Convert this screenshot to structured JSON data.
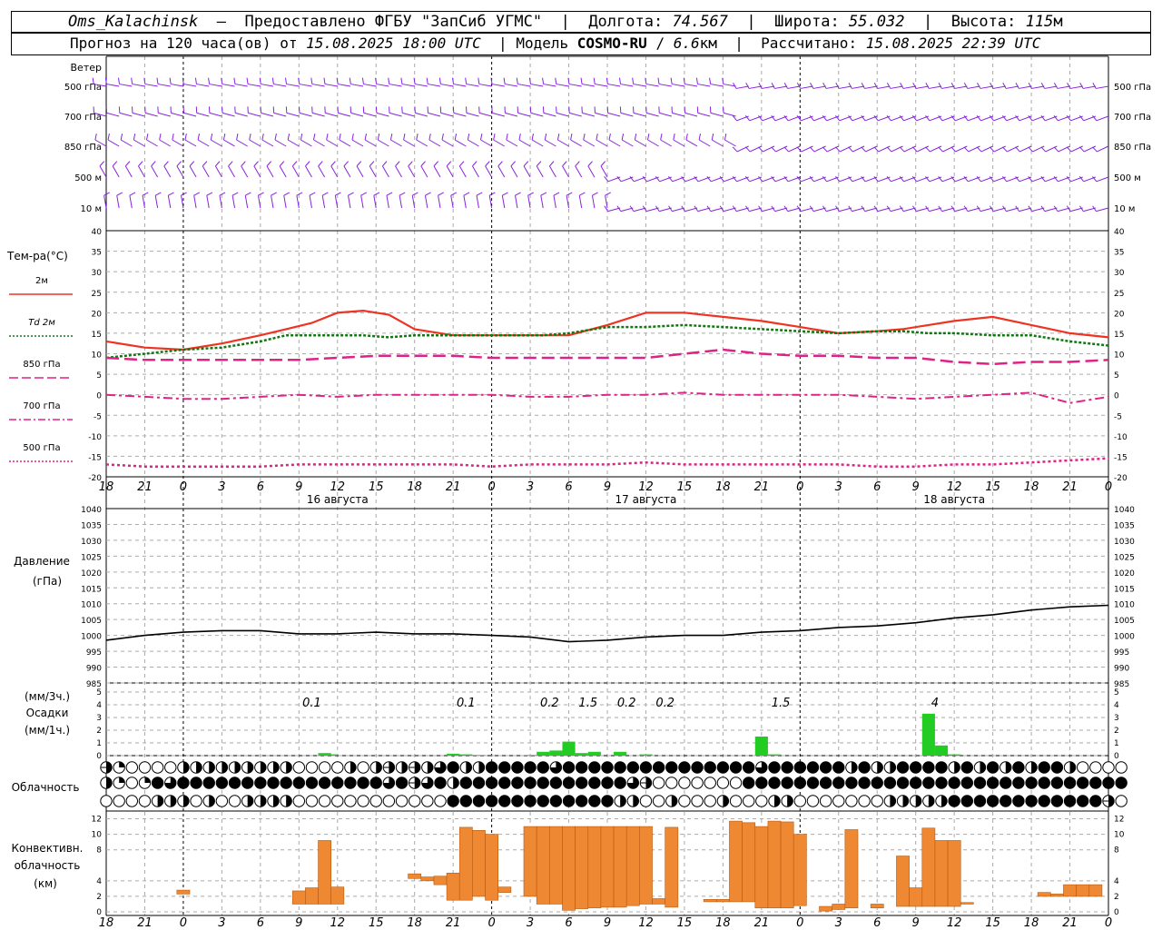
{
  "header": {
    "station": "Oms_Kalachinsk",
    "dash": "–",
    "provider": "Предоставлено ФГБУ \"ЗапСиб УГМС\"",
    "sep": "|",
    "lon_label": "Долгота:",
    "lon_value": "74.567",
    "lat_label": "Широта:",
    "lat_value": "55.032",
    "alt_label": "Высота:",
    "alt_value": "115",
    "alt_unit": "м",
    "forecast_label": "Прогноз на 120 часа(ов) от",
    "forecast_from": "15.08.2025 18:00 UTC",
    "model_label": "Модель",
    "model_name": "COSMO-RU",
    "model_slash": "/",
    "model_res": "6.6",
    "model_res_unit": "км",
    "calc_label": "Рассчитано:",
    "calc_time": "15.08.2025 22:39 UTC"
  },
  "labels": {
    "wind": "Ветер",
    "wind_levels": [
      "500 гПа",
      "700 гПа",
      "850 гПа",
      "500 м",
      "10  м"
    ],
    "temp_title": "Тем-ра(°С)",
    "temp_legend": [
      "2м",
      "Td  2м",
      "850 гПа",
      "700 гПа",
      "500 гПа"
    ],
    "pressure_title": "Давление",
    "pressure_unit": "(гПа)",
    "precip_unit3": "(мм/3ч.)",
    "precip_title": "Осадки",
    "precip_unit1": "(мм/1ч.)",
    "cloud_title": "Облачность",
    "conv_title": "Конвективн.",
    "conv_title2": "облачность",
    "conv_unit": "(км)",
    "days": [
      "16 августа",
      "17 августа",
      "18 августа"
    ]
  },
  "colors": {
    "t2m": "#ee3322",
    "td2m": "#117711",
    "t850": "#dd2288",
    "t700": "#dd2288",
    "t500": "#dd2288",
    "wind": "#8822dd",
    "precip": "#22cc22",
    "conv": "#ee8833",
    "grid": "#aaaaaa",
    "pressure": "#000000"
  },
  "chart_data": {
    "type": "line",
    "x_ticks": [
      "18",
      "21",
      "0",
      "3",
      "6",
      "9",
      "12",
      "15",
      "18",
      "21",
      "0",
      "3",
      "6",
      "9",
      "12",
      "15",
      "18",
      "21",
      "0",
      "3",
      "6",
      "9",
      "12",
      "15",
      "18",
      "21",
      "0"
    ],
    "x_hours": [
      0,
      78
    ],
    "temperature": {
      "ylim": [
        -20,
        40
      ],
      "yticks": [
        40,
        35,
        30,
        25,
        20,
        15,
        10,
        5,
        0,
        -5,
        -10,
        -15,
        -20
      ],
      "series": [
        {
          "name": "2м",
          "x": [
            0,
            3,
            6,
            9,
            12,
            14,
            16,
            18,
            20,
            22,
            24,
            27,
            30,
            32,
            34,
            36,
            39,
            42,
            45,
            48,
            51,
            54,
            57,
            60,
            62,
            64,
            66,
            69,
            72,
            75,
            78
          ],
          "values": [
            13,
            11.5,
            11,
            12.5,
            14.5,
            16,
            17.5,
            20,
            20.5,
            19.5,
            16,
            14.5,
            14.5,
            14.5,
            14.5,
            14.5,
            17,
            20,
            20,
            19,
            18,
            16.5,
            15,
            15.5,
            16,
            17,
            18,
            19,
            17,
            15,
            14
          ]
        },
        {
          "name": "Td  2м",
          "x": [
            0,
            3,
            6,
            9,
            12,
            14,
            16,
            18,
            20,
            22,
            24,
            27,
            30,
            32,
            34,
            36,
            39,
            42,
            45,
            48,
            51,
            54,
            57,
            60,
            62,
            64,
            66,
            69,
            72,
            75,
            78
          ],
          "values": [
            9,
            10,
            11,
            11.5,
            13,
            14.5,
            14.5,
            14.5,
            14.5,
            14,
            14.5,
            14.5,
            14.5,
            14.5,
            14.5,
            15,
            16.5,
            16.5,
            17,
            16.5,
            16,
            15.5,
            15,
            15.5,
            15.5,
            15,
            15,
            14.5,
            14.5,
            13,
            12
          ]
        },
        {
          "name": "850 гПа",
          "x": [
            0,
            3,
            6,
            9,
            12,
            15,
            18,
            21,
            24,
            27,
            30,
            33,
            36,
            39,
            42,
            45,
            48,
            51,
            54,
            57,
            60,
            63,
            66,
            69,
            72,
            75,
            78
          ],
          "values": [
            9,
            8.5,
            8.5,
            8.5,
            8.5,
            8.5,
            9,
            9.5,
            9.5,
            9.5,
            9,
            9,
            9,
            9,
            9,
            10,
            11,
            10,
            9.5,
            9.5,
            9,
            9,
            8,
            7.5,
            8,
            8,
            8.5
          ]
        },
        {
          "name": "700 гПа",
          "x": [
            0,
            3,
            6,
            9,
            12,
            15,
            18,
            21,
            24,
            27,
            30,
            33,
            36,
            39,
            42,
            45,
            48,
            51,
            54,
            57,
            60,
            63,
            66,
            69,
            72,
            75,
            78
          ],
          "values": [
            0,
            -0.5,
            -1,
            -1,
            -0.5,
            0,
            -0.5,
            0,
            0,
            0,
            0,
            -0.5,
            -0.5,
            0,
            0,
            0.5,
            0,
            0,
            0,
            0,
            -0.5,
            -1,
            -0.5,
            0,
            0.5,
            -2,
            -0.5
          ]
        },
        {
          "name": "500 гПа",
          "x": [
            0,
            3,
            6,
            9,
            12,
            15,
            18,
            21,
            24,
            27,
            30,
            33,
            36,
            39,
            42,
            45,
            48,
            51,
            54,
            57,
            60,
            63,
            66,
            69,
            72,
            75,
            78
          ],
          "values": [
            -17,
            -17.5,
            -17.5,
            -17.5,
            -17.5,
            -17,
            -17,
            -17,
            -17,
            -17,
            -17.5,
            -17,
            -17,
            -17,
            -16.5,
            -17,
            -17,
            -17,
            -17,
            -17,
            -17.5,
            -17.5,
            -17,
            -17,
            -16.5,
            -16,
            -15.5
          ]
        }
      ]
    },
    "pressure": {
      "ylim": [
        985,
        1040
      ],
      "yticks": [
        1040,
        1035,
        1030,
        1025,
        1020,
        1015,
        1010,
        1005,
        1000,
        995,
        990,
        985
      ],
      "x": [
        0,
        3,
        6,
        9,
        12,
        15,
        18,
        21,
        24,
        27,
        30,
        33,
        36,
        39,
        42,
        45,
        48,
        51,
        54,
        57,
        60,
        63,
        66,
        69,
        72,
        75,
        78
      ],
      "values": [
        998.5,
        1000,
        1001,
        1001.5,
        1001.5,
        1000.5,
        1000.5,
        1001,
        1000.5,
        1000.5,
        1000,
        999.5,
        998,
        998.5,
        999.5,
        1000,
        1000,
        1001,
        1001.5,
        1002.5,
        1003,
        1004,
        1005.5,
        1006.5,
        1008,
        1009,
        1009.5
      ]
    },
    "precipitation": {
      "ylim": [
        0,
        5
      ],
      "yticks": [
        5,
        4,
        3,
        2,
        1,
        0
      ],
      "x": [
        17,
        17.5,
        27,
        28,
        29,
        33,
        34,
        35,
        36,
        37,
        38,
        40,
        42,
        51,
        52,
        64,
        65,
        66
      ],
      "values": [
        0.2,
        0.1,
        0.15,
        0.1,
        0.05,
        0.05,
        0.3,
        0.4,
        1.1,
        0.2,
        0.3,
        0.3,
        0.1,
        1.5,
        0.1,
        3.3,
        0.8,
        0.1
      ],
      "labels3h": [
        {
          "x": 16,
          "text": "0.1"
        },
        {
          "x": 28,
          "text": "0.1"
        },
        {
          "x": 34.5,
          "text": "0.2"
        },
        {
          "x": 37.5,
          "text": "1.5"
        },
        {
          "x": 40.5,
          "text": "0.2"
        },
        {
          "x": 43.5,
          "text": "0.2"
        },
        {
          "x": 52.5,
          "text": "1.5"
        },
        {
          "x": 64.5,
          "text": "4"
        }
      ]
    },
    "convective_cloud": {
      "ylim": [
        0,
        13
      ],
      "yticks": [
        12,
        10,
        8,
        4,
        2,
        0
      ],
      "bars": [
        {
          "x": 6,
          "bottom": 2.3,
          "top": 2.8
        },
        {
          "x": 15,
          "bottom": 1,
          "top": 2.7
        },
        {
          "x": 16,
          "bottom": 1,
          "top": 3.1
        },
        {
          "x": 17,
          "bottom": 1,
          "top": 9.2
        },
        {
          "x": 18,
          "bottom": 1,
          "top": 3.2
        },
        {
          "x": 24,
          "bottom": 4.3,
          "top": 4.9
        },
        {
          "x": 25,
          "bottom": 4,
          "top": 4.5
        },
        {
          "x": 26,
          "bottom": 3.5,
          "top": 4.6
        },
        {
          "x": 27,
          "bottom": 1.5,
          "top": 5
        },
        {
          "x": 28,
          "bottom": 1.5,
          "top": 10.9
        },
        {
          "x": 29,
          "bottom": 2,
          "top": 10.5
        },
        {
          "x": 30,
          "bottom": 1.5,
          "top": 10
        },
        {
          "x": 31,
          "bottom": 2.5,
          "top": 3.2
        },
        {
          "x": 33,
          "bottom": 2,
          "top": 11
        },
        {
          "x": 34,
          "bottom": 1,
          "top": 11
        },
        {
          "x": 35,
          "bottom": 1,
          "top": 11
        },
        {
          "x": 36,
          "bottom": 0.2,
          "top": 11
        },
        {
          "x": 37,
          "bottom": 0.4,
          "top": 11
        },
        {
          "x": 38,
          "bottom": 0.5,
          "top": 11
        },
        {
          "x": 39,
          "bottom": 0.6,
          "top": 11
        },
        {
          "x": 40,
          "bottom": 0.6,
          "top": 11
        },
        {
          "x": 41,
          "bottom": 0.8,
          "top": 11
        },
        {
          "x": 42,
          "bottom": 1,
          "top": 11
        },
        {
          "x": 43,
          "bottom": 1,
          "top": 1.7
        },
        {
          "x": 44,
          "bottom": 0.6,
          "top": 10.9
        },
        {
          "x": 47,
          "bottom": 1.3,
          "top": 1.6
        },
        {
          "x": 48,
          "bottom": 1.3,
          "top": 1.6
        },
        {
          "x": 49,
          "bottom": 1.3,
          "top": 11.7
        },
        {
          "x": 50,
          "bottom": 1.3,
          "top": 11.5
        },
        {
          "x": 51,
          "bottom": 0.5,
          "top": 11
        },
        {
          "x": 52,
          "bottom": 0.5,
          "top": 11.7
        },
        {
          "x": 53,
          "bottom": 0.5,
          "top": 11.6
        },
        {
          "x": 54,
          "bottom": 0.8,
          "top": 10
        },
        {
          "x": 56,
          "bottom": 0.1,
          "top": 0.7
        },
        {
          "x": 57,
          "bottom": 0.3,
          "top": 1
        },
        {
          "x": 58,
          "bottom": 0.5,
          "top": 10.6
        },
        {
          "x": 60,
          "bottom": 0.5,
          "top": 1
        },
        {
          "x": 62,
          "bottom": 0.7,
          "top": 7.2
        },
        {
          "x": 63,
          "bottom": 0.7,
          "top": 3.1
        },
        {
          "x": 64,
          "bottom": 0.7,
          "top": 10.8
        },
        {
          "x": 65,
          "bottom": 0.7,
          "top": 9.2
        },
        {
          "x": 66,
          "bottom": 0.7,
          "top": 9.2
        },
        {
          "x": 67,
          "bottom": 1,
          "top": 1.2
        },
        {
          "x": 73,
          "bottom": 2,
          "top": 2.5
        },
        {
          "x": 74,
          "bottom": 2,
          "top": 2.3
        },
        {
          "x": 75,
          "bottom": 2,
          "top": 3.5
        },
        {
          "x": 76,
          "bottom": 2,
          "top": 3.5
        },
        {
          "x": 77,
          "bottom": 2,
          "top": 3.5
        }
      ]
    },
    "cloudiness": {
      "rows": [
        "high",
        "middle",
        "low"
      ],
      "octa_high": [
        5,
        2,
        0,
        0,
        0,
        0,
        4,
        4,
        4,
        4,
        4,
        4,
        4,
        4,
        4,
        0,
        0,
        0,
        0,
        4,
        0,
        4,
        5,
        4,
        5,
        4,
        6,
        8,
        4,
        4,
        8,
        8,
        8,
        8,
        8,
        6,
        8,
        8,
        8,
        8,
        8,
        8,
        8,
        8,
        8,
        8,
        8,
        8,
        8,
        8,
        8,
        6,
        8,
        8,
        8,
        8,
        8,
        8,
        4,
        8,
        4,
        4,
        8,
        8,
        8,
        8,
        4,
        8,
        4,
        8,
        4,
        8,
        4,
        8,
        8,
        4,
        0,
        0,
        0,
        0
      ],
      "octa_middle": [
        4,
        2,
        0,
        2,
        8,
        6,
        8,
        8,
        8,
        8,
        8,
        8,
        8,
        8,
        8,
        8,
        8,
        8,
        8,
        8,
        8,
        8,
        6,
        8,
        5,
        6,
        8,
        4,
        8,
        8,
        8,
        8,
        8,
        8,
        8,
        8,
        8,
        8,
        8,
        8,
        8,
        6,
        5,
        0,
        0,
        0,
        0,
        0,
        0,
        0,
        8,
        8,
        8,
        8,
        8,
        8,
        8,
        8,
        8,
        8,
        8,
        8,
        8,
        8,
        8,
        8,
        8,
        8,
        8,
        8,
        8,
        8,
        8,
        8,
        8,
        8,
        8,
        8,
        8,
        8
      ],
      "octa_low": [
        0,
        0,
        0,
        0,
        4,
        4,
        4,
        0,
        4,
        0,
        0,
        4,
        4,
        4,
        4,
        0,
        0,
        0,
        0,
        0,
        0,
        0,
        0,
        0,
        0,
        0,
        0,
        8,
        8,
        8,
        8,
        8,
        8,
        8,
        8,
        8,
        8,
        8,
        8,
        8,
        4,
        4,
        0,
        0,
        4,
        0,
        0,
        0,
        4,
        0,
        0,
        0,
        4,
        4,
        0,
        0,
        0,
        0,
        0,
        0,
        0,
        4,
        4,
        4,
        4,
        4,
        8,
        8,
        8,
        8,
        8,
        8,
        8,
        8,
        8,
        8,
        8,
        8,
        5,
        0
      ]
    }
  }
}
